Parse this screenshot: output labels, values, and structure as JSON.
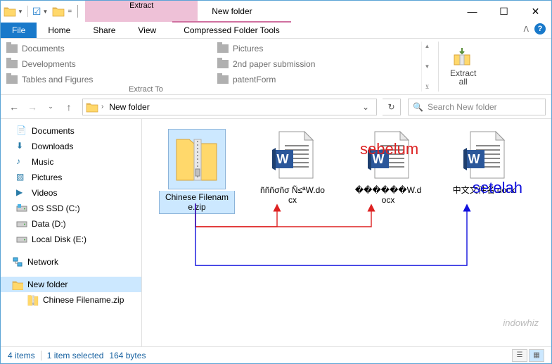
{
  "titlebar": {
    "context_group": "Extract",
    "context_tab": "Compressed Folder Tools",
    "window_title": "New folder"
  },
  "tabs": {
    "file": "File",
    "home": "Home",
    "share": "Share",
    "view": "View"
  },
  "ribbon": {
    "group_label": "Extract To",
    "extract_all": "Extract\nall",
    "destinations": [
      "Documents",
      "Pictures",
      "Developments",
      "2nd paper submission",
      "Tables and Figures",
      "patentForm"
    ]
  },
  "address": {
    "segments": [
      "New folder"
    ],
    "search_placeholder": "Search New folder"
  },
  "tree": [
    {
      "label": "Documents",
      "icon": "folder-doc"
    },
    {
      "label": "Downloads",
      "icon": "downloads"
    },
    {
      "label": "Music",
      "icon": "music"
    },
    {
      "label": "Pictures",
      "icon": "pictures"
    },
    {
      "label": "Videos",
      "icon": "videos"
    },
    {
      "label": "OS SSD (C:)",
      "icon": "drive-os"
    },
    {
      "label": "Data (D:)",
      "icon": "drive"
    },
    {
      "label": "Local Disk (E:)",
      "icon": "drive"
    }
  ],
  "tree_network": "Network",
  "tree_new_folder": "New folder",
  "tree_zip": "Chinese Filename.zip",
  "files": [
    {
      "name": "Chinese Filename.zip",
      "type": "zip",
      "selected": true
    },
    {
      "name": "ñññσñσ Ñ≤ªW.docx",
      "type": "docx"
    },
    {
      "name": "������W.docx",
      "type": "docx"
    },
    {
      "name": "中文文件名.docx",
      "type": "docx"
    }
  ],
  "annotations": {
    "before": "sebelum",
    "after": "setelah"
  },
  "watermark": "indowhiz",
  "status": {
    "count": "4 items",
    "selection": "1 item selected",
    "size": "164 bytes"
  }
}
